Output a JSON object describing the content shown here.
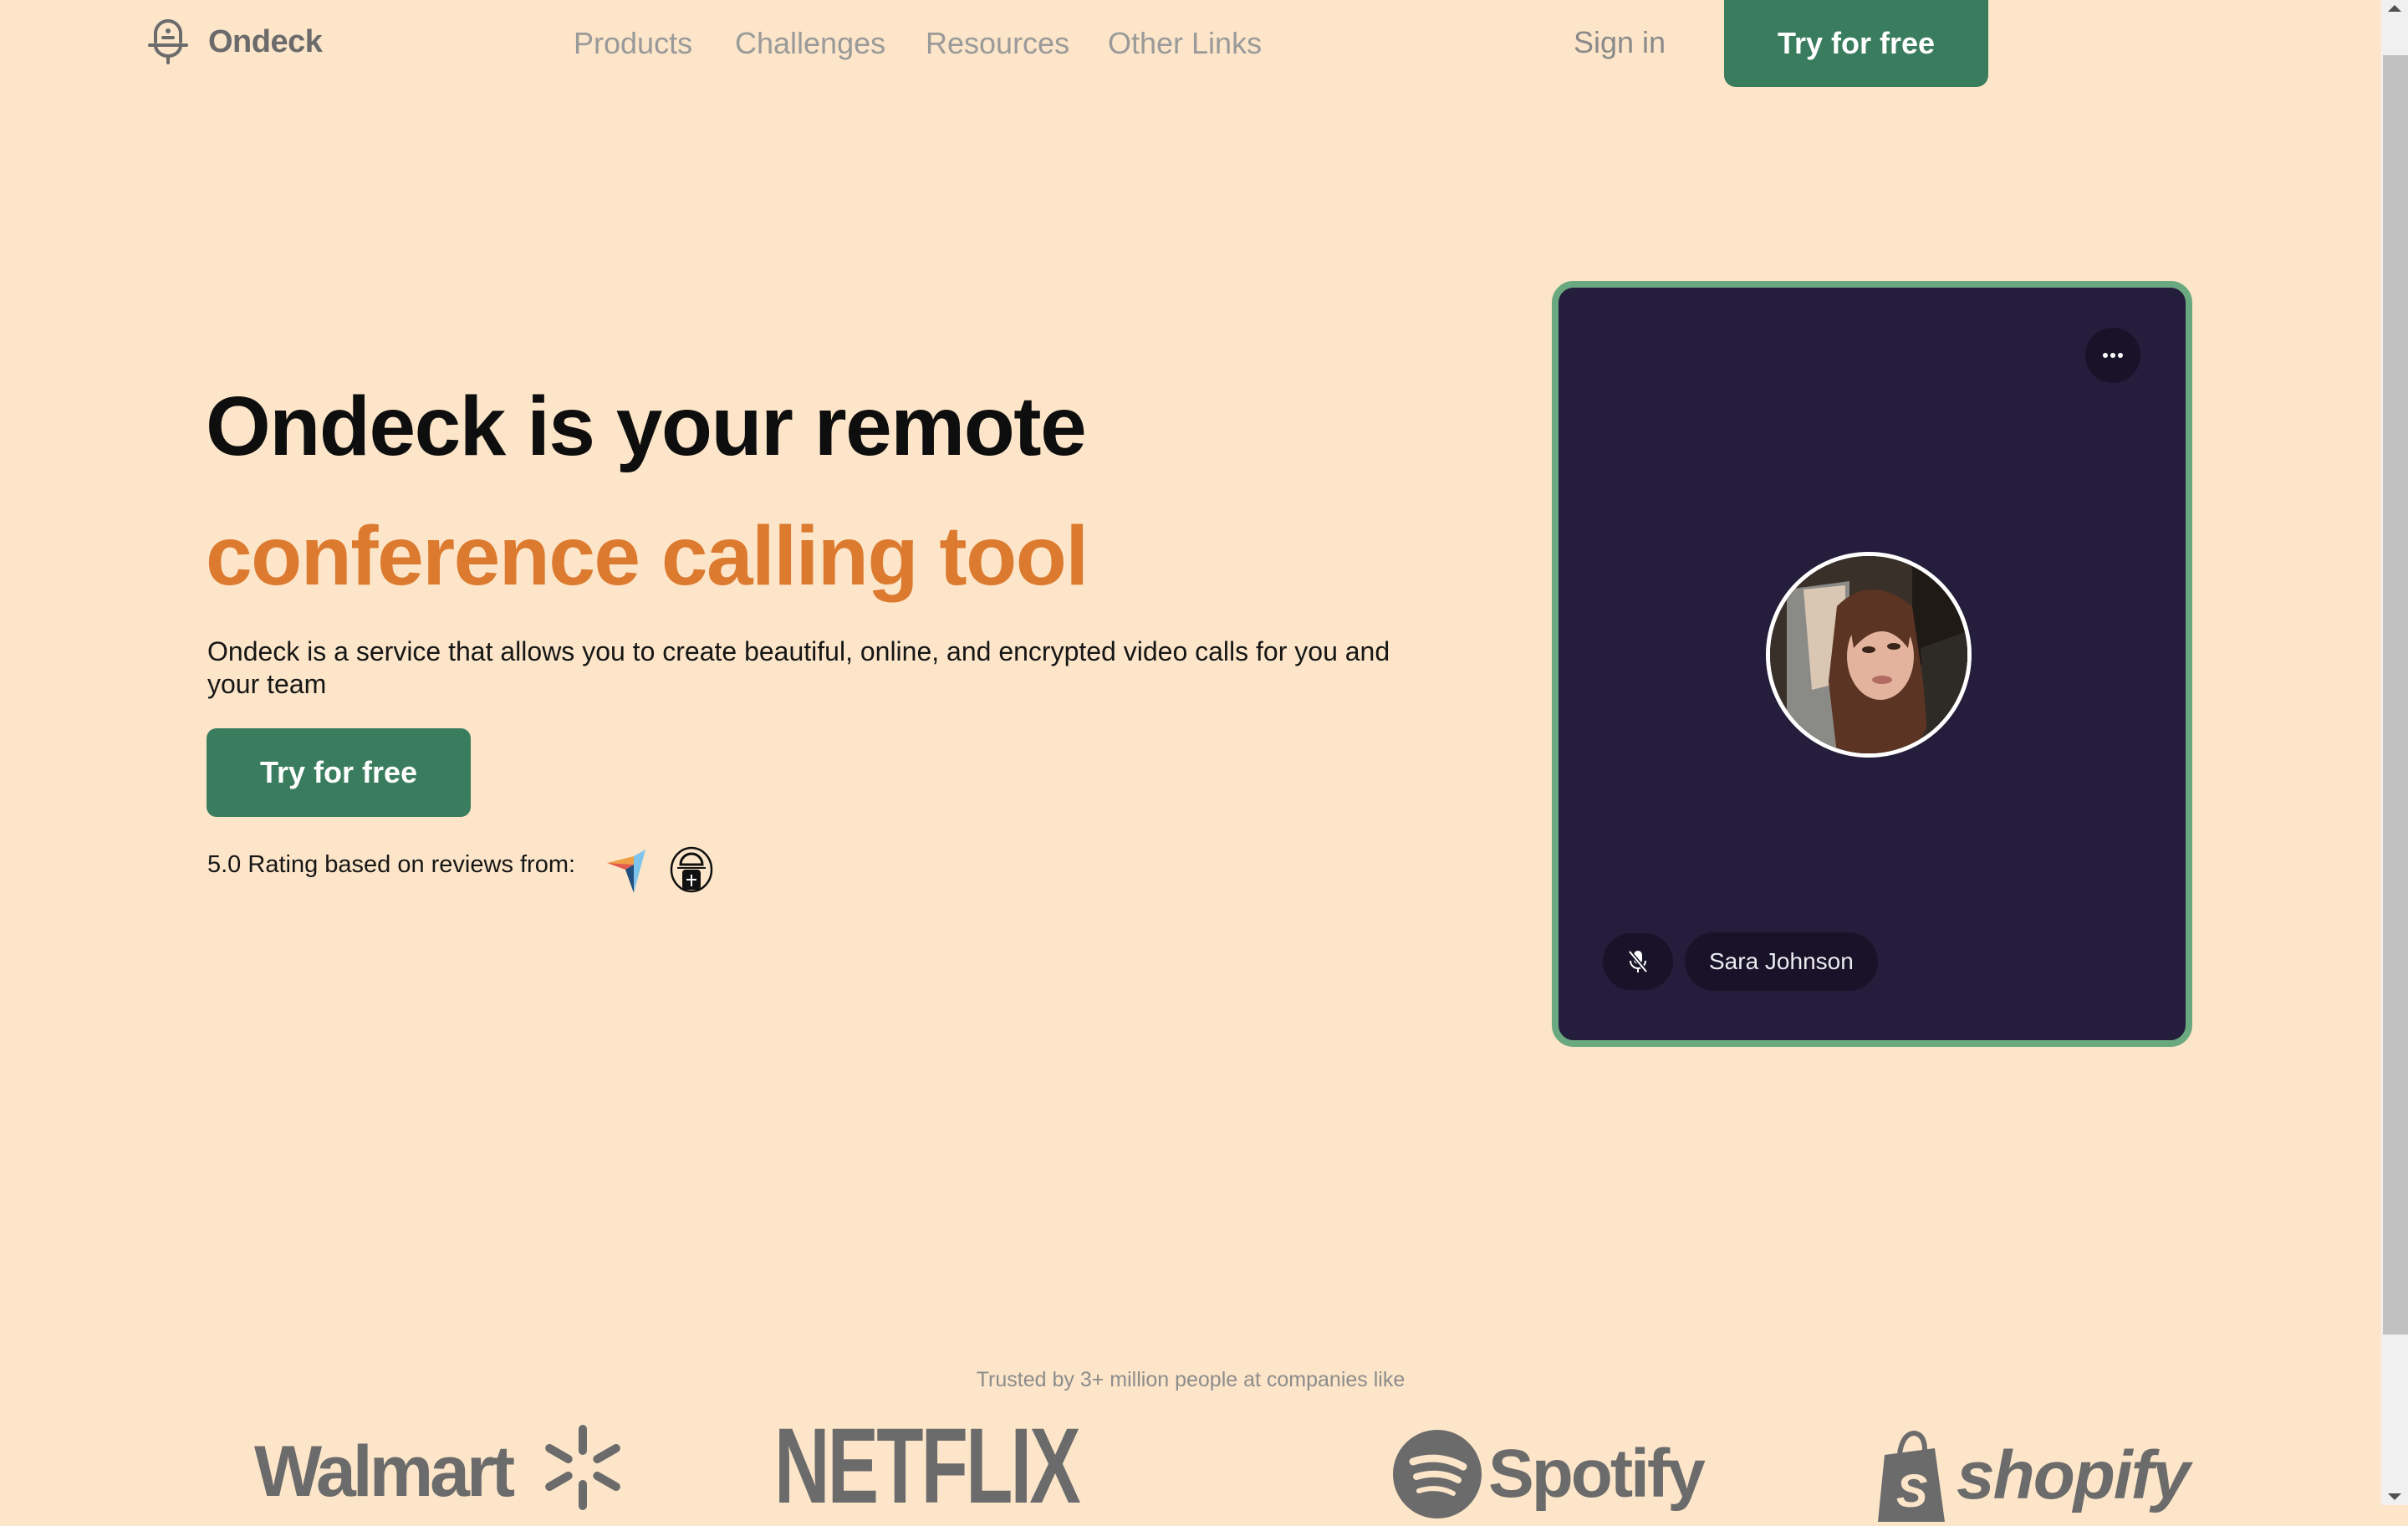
{
  "header": {
    "brand": "Ondeck",
    "logo_icon": "microphone-bell-icon",
    "nav": [
      {
        "label": "Products"
      },
      {
        "label": "Challenges"
      },
      {
        "label": "Resources"
      },
      {
        "label": "Other Links"
      }
    ],
    "sign_in": "Sign in",
    "cta": "Try for free"
  },
  "hero": {
    "title_line1": "Ondeck is your remote",
    "title_line2": "conference calling tool",
    "description": "Ondeck is a service that allows you to create beautiful, online, and encrypted video calls for you and your team",
    "cta": "Try for free",
    "rating_text": "5.0 Rating based on reviews from:",
    "review_sources": [
      "paper-plane-logo-icon",
      "product-hunt-cat-logo-icon"
    ]
  },
  "video_card": {
    "more_icon": "more-dots-icon",
    "participant_name": "Sara Johnson",
    "mic_status": "muted",
    "mic_icon": "mic-off-icon"
  },
  "trusted": {
    "text": "Trusted by 3+ million people at companies like",
    "companies": [
      "Walmart",
      "NETFLIX",
      "Spotify",
      "shopify"
    ]
  },
  "colors": {
    "background": "#fce5c8",
    "primary_green": "#3a7c5e",
    "accent_orange": "#dc7a2f",
    "card_bg": "#241d3b",
    "card_border": "#6aa87f"
  }
}
